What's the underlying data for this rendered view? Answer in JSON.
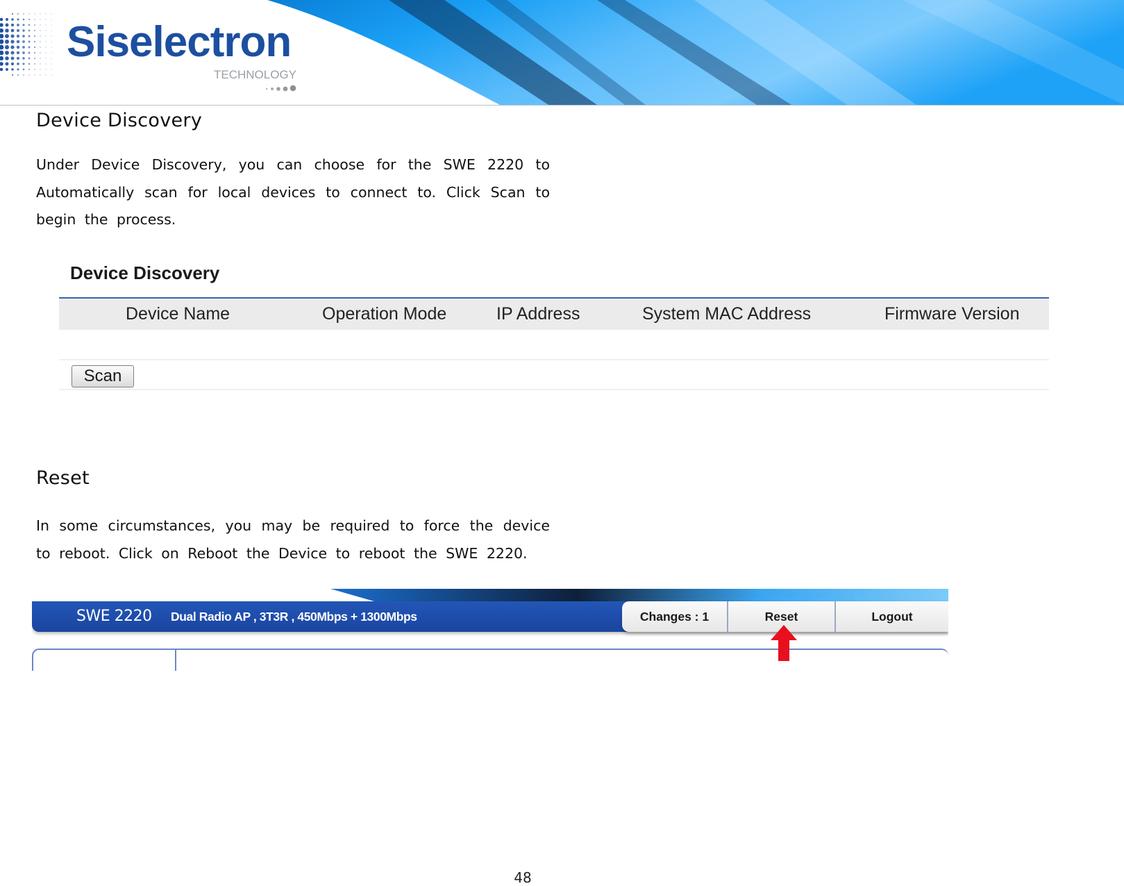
{
  "header": {
    "brand_name": "Siselectron",
    "brand_tagline": "TECHNOLOGY",
    "brand_color": "#1d4fa0",
    "banner_accent": "#0a8ee8"
  },
  "sections": {
    "device_discovery": {
      "heading": "Device Discovery",
      "paragraph": "Under Device Discovery, you can choose for the SWE 2220 to Automatically scan for local devices to connect to. Click Scan to begin the process."
    },
    "reset": {
      "heading": "Reset",
      "paragraph": "In some circumstances, you may be required to force the device to reboot. Click on Reboot the Device to reboot the SWE 2220."
    }
  },
  "device_discovery_panel": {
    "title": "Device Discovery",
    "columns": [
      "Device Name",
      "Operation Mode",
      "IP Address",
      "System MAC Address",
      "Firmware Version"
    ],
    "rows": [],
    "scan_button": "Scan",
    "header_line_color": "#3a65ad"
  },
  "swe_header": {
    "model": "SWE 2220",
    "description": "Dual Radio AP , 3T3R , 450Mbps + 1300Mbps",
    "buttons": [
      "Changes : 1",
      "Reset",
      "Logout"
    ],
    "highlighted_button": "Reset",
    "bar_color": "#2356b7",
    "arrow_color": "#e8101e",
    "arrow_icon": "arrow-up-icon"
  },
  "footer": {
    "page_number": "48"
  }
}
